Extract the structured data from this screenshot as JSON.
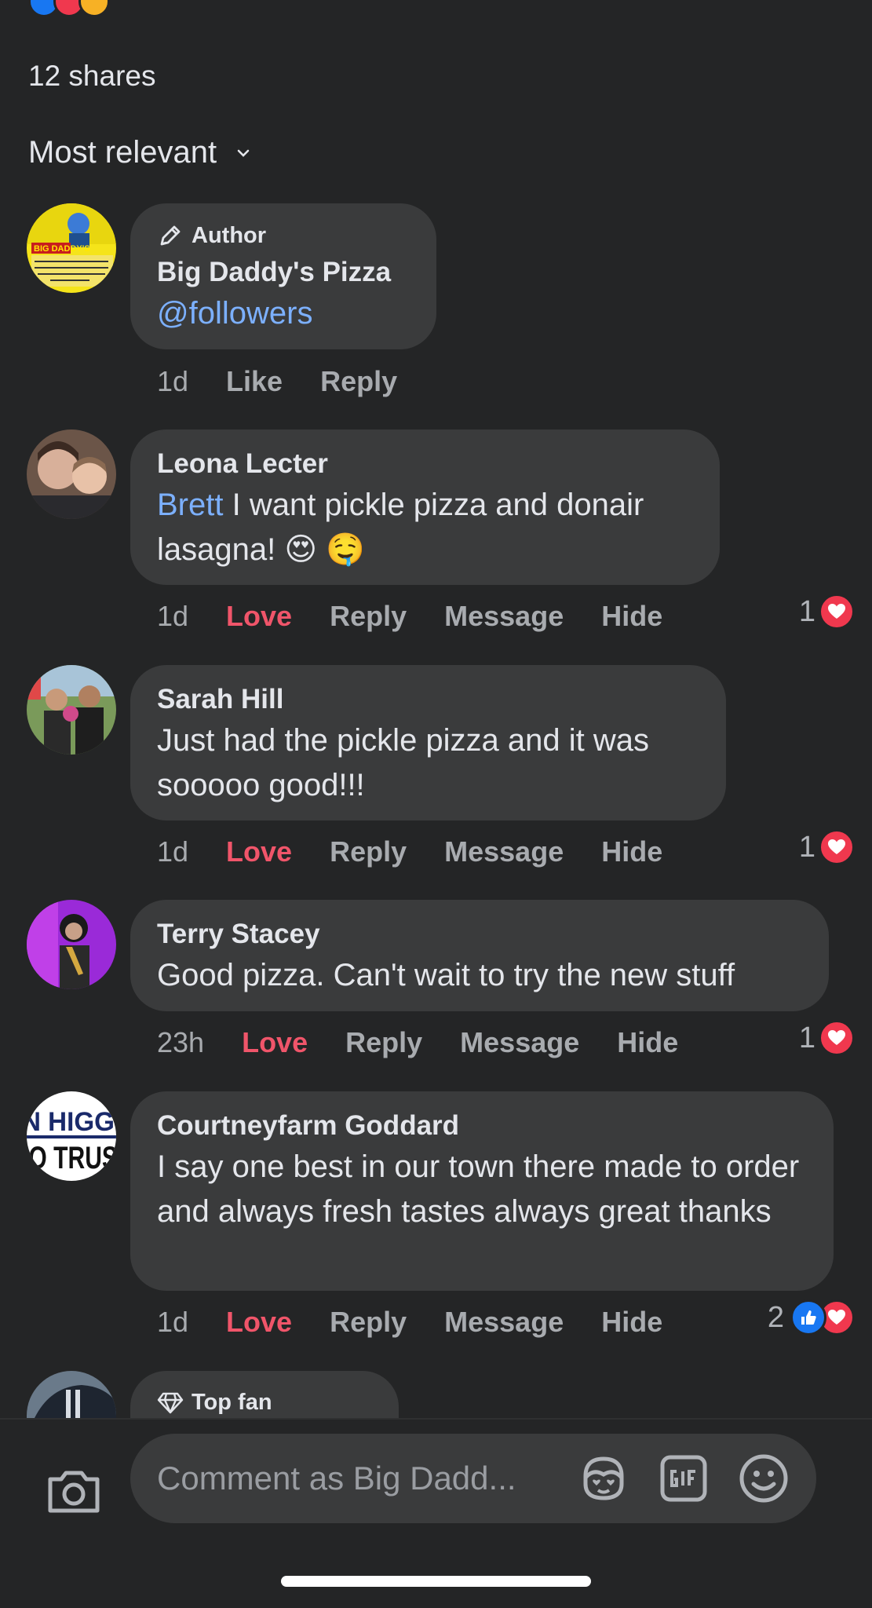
{
  "shares": "12 shares",
  "sort": {
    "label": "Most relevant"
  },
  "comments": [
    {
      "badge": "Author",
      "name": "Big Daddy's Pizza",
      "mention": "@followers",
      "text": "",
      "time": "1d",
      "like_label": "Like",
      "reply_label": "Reply"
    },
    {
      "name": "Leona Lecter",
      "mention": "Brett",
      "text": " I want pickle pizza and donair lasagna! 😍 🤤",
      "time": "1d",
      "love_label": "Love",
      "reply_label": "Reply",
      "message_label": "Message",
      "hide_label": "Hide",
      "reaction_count": "1"
    },
    {
      "name": "Sarah Hill",
      "text": "Just had the pickle pizza and it was sooooo good!!!",
      "time": "1d",
      "love_label": "Love",
      "reply_label": "Reply",
      "message_label": "Message",
      "hide_label": "Hide",
      "reaction_count": "1"
    },
    {
      "name": "Terry Stacey",
      "text": "Good pizza. Can't wait to try the new stuff",
      "time": "23h",
      "love_label": "Love",
      "reply_label": "Reply",
      "message_label": "Message",
      "hide_label": "Hide",
      "reaction_count": "1"
    },
    {
      "name": "Courtneyfarm Goddard",
      "text": "I say one best in our town there made to order and always fresh tastes always great thanks",
      "time": "1d",
      "love_label": "Love",
      "reply_label": "Reply",
      "message_label": "Message",
      "hide_label": "Hide",
      "reaction_count": "2"
    },
    {
      "badge": "Top fan"
    }
  ],
  "avatars": {
    "big_daddys_sign": "BIG DADDY'S",
    "higgs_line1": "N HIGG",
    "higgs_line2": "IO TRUS"
  },
  "composer": {
    "placeholder": "Comment as Big Dadd..."
  },
  "colors": {
    "background": "#242526",
    "bubble": "#3a3b3c",
    "love": "#f0556a",
    "mention": "#7cb0ff",
    "like_blue": "#1877f2"
  }
}
